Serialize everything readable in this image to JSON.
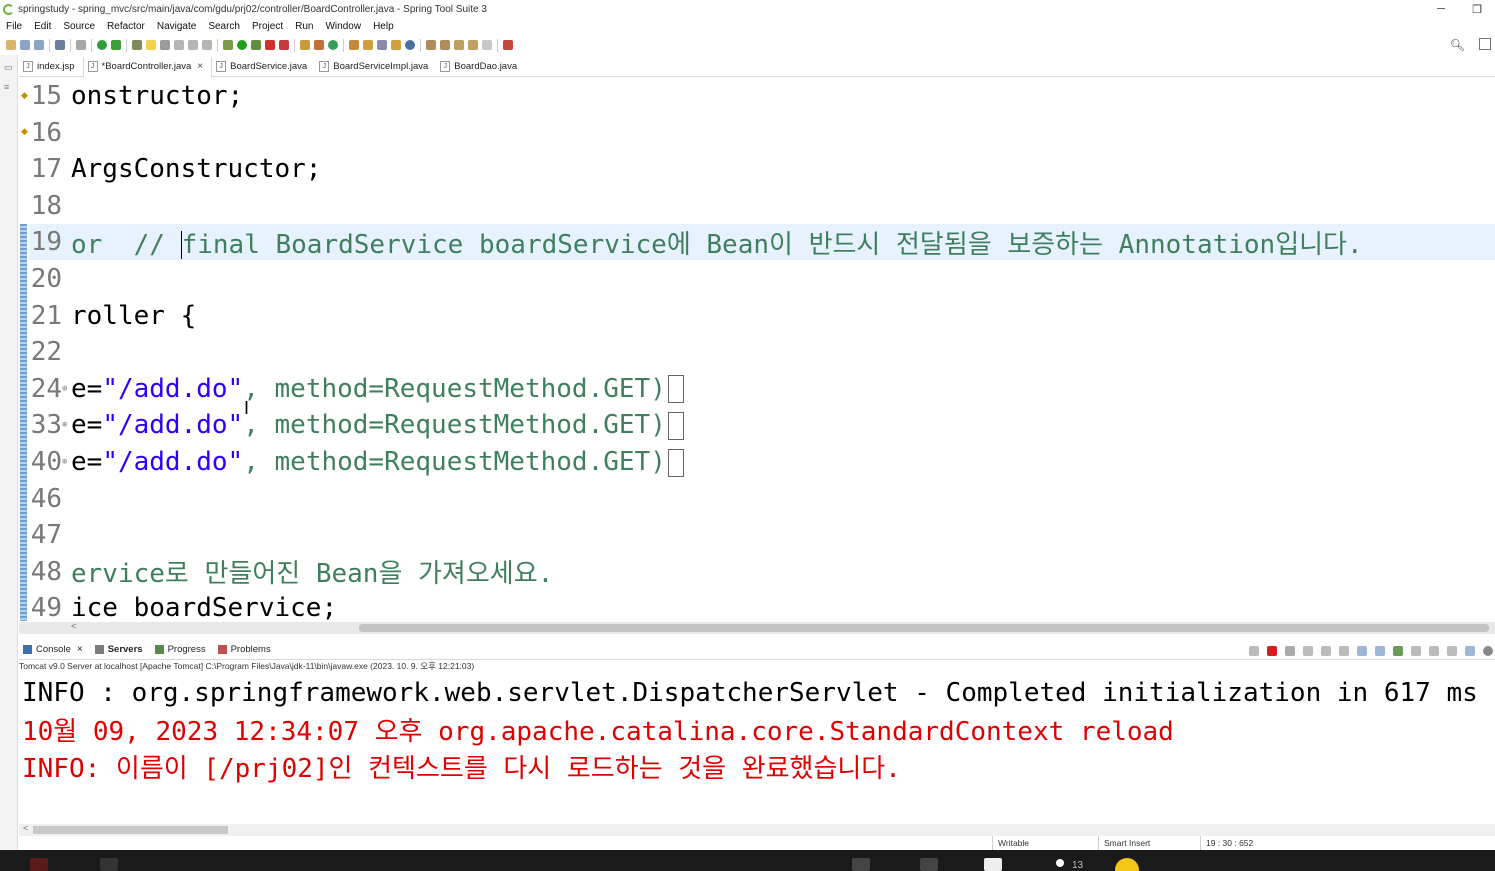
{
  "window": {
    "title": "springstudy - spring_mvc/src/main/java/com/gdu/prj02/controller/BoardController.java - Spring Tool Suite 3",
    "minimize": "─",
    "restore": "❐"
  },
  "menu": [
    "File",
    "Edit",
    "Source",
    "Refactor",
    "Navigate",
    "Search",
    "Project",
    "Run",
    "Window",
    "Help"
  ],
  "editor_tabs": [
    {
      "label": "index.jsp",
      "active": false,
      "icon": "jsp-file-icon"
    },
    {
      "label": "*BoardController.java",
      "active": true,
      "icon": "java-file-icon"
    },
    {
      "label": "BoardService.java",
      "active": false,
      "icon": "java-file-icon"
    },
    {
      "label": "BoardServiceImpl.java",
      "active": false,
      "icon": "java-file-icon"
    },
    {
      "label": "BoardDao.java",
      "active": false,
      "icon": "java-file-icon"
    }
  ],
  "code_lines": [
    {
      "num": "15",
      "text": "onstructor;"
    },
    {
      "num": "16",
      "text": ""
    },
    {
      "num": "17",
      "text": "ArgsConstructor;"
    },
    {
      "num": "18",
      "text": ""
    },
    {
      "num": "19",
      "text_before": "or  // ",
      "comment": "final BoardService boardService에 Bean이 반드시 전달됨을 보증하는 Annotation입니다."
    },
    {
      "num": "20",
      "text": ""
    },
    {
      "num": "21",
      "text": "roller {"
    },
    {
      "num": "22",
      "text": ""
    },
    {
      "num": "24",
      "pre": "e=",
      "str": "\"/add.do\"",
      "post": ", method=RequestMethod.GET)"
    },
    {
      "num": "33",
      "pre": "e=",
      "str": "\"/add.do\"",
      "post": ", method=RequestMethod.GET)"
    },
    {
      "num": "40",
      "pre": "e=",
      "str": "\"/add.do\"",
      "post": ", method=RequestMethod.GET)"
    },
    {
      "num": "46",
      "text": ""
    },
    {
      "num": "47",
      "text": ""
    },
    {
      "num": "48",
      "comment": "ervice로 만들어진 Bean을 가져오세요."
    },
    {
      "num": "49",
      "text": "ice boardService;"
    }
  ],
  "console_tabs": [
    {
      "label": "Console",
      "bold": false
    },
    {
      "label": "Servers",
      "bold": true
    },
    {
      "label": "Progress",
      "bold": false
    },
    {
      "label": "Problems",
      "bold": false
    }
  ],
  "console_description": "Tomcat v9.0 Server at localhost [Apache Tomcat] C:\\Program Files\\Java\\jdk-11\\bin\\javaw.exe  (2023. 10. 9. 오후 12:21:03)",
  "console_lines": [
    {
      "text": "INFO : org.springframework.web.servlet.DispatcherServlet - Completed initialization in 617 ms",
      "kind": "info"
    },
    {
      "text": "10월 09, 2023 12:34:07 오후 org.apache.catalina.core.StandardContext reload",
      "kind": "err"
    },
    {
      "text": "INFO: 이름이 [/prj02]인 컨텍스트를 다시 로드하는 것을 완료했습니다.",
      "kind": "err"
    }
  ],
  "status": {
    "writable": "Writable",
    "insert_mode": "Smart Insert",
    "position": "19 : 30 : 652"
  },
  "taskbar": {
    "badge_count": "13"
  },
  "colors": {
    "comment": "#3f7f5f",
    "string": "#2a00ff",
    "console_error": "#e00000",
    "current_line": "#e8f2fe"
  }
}
